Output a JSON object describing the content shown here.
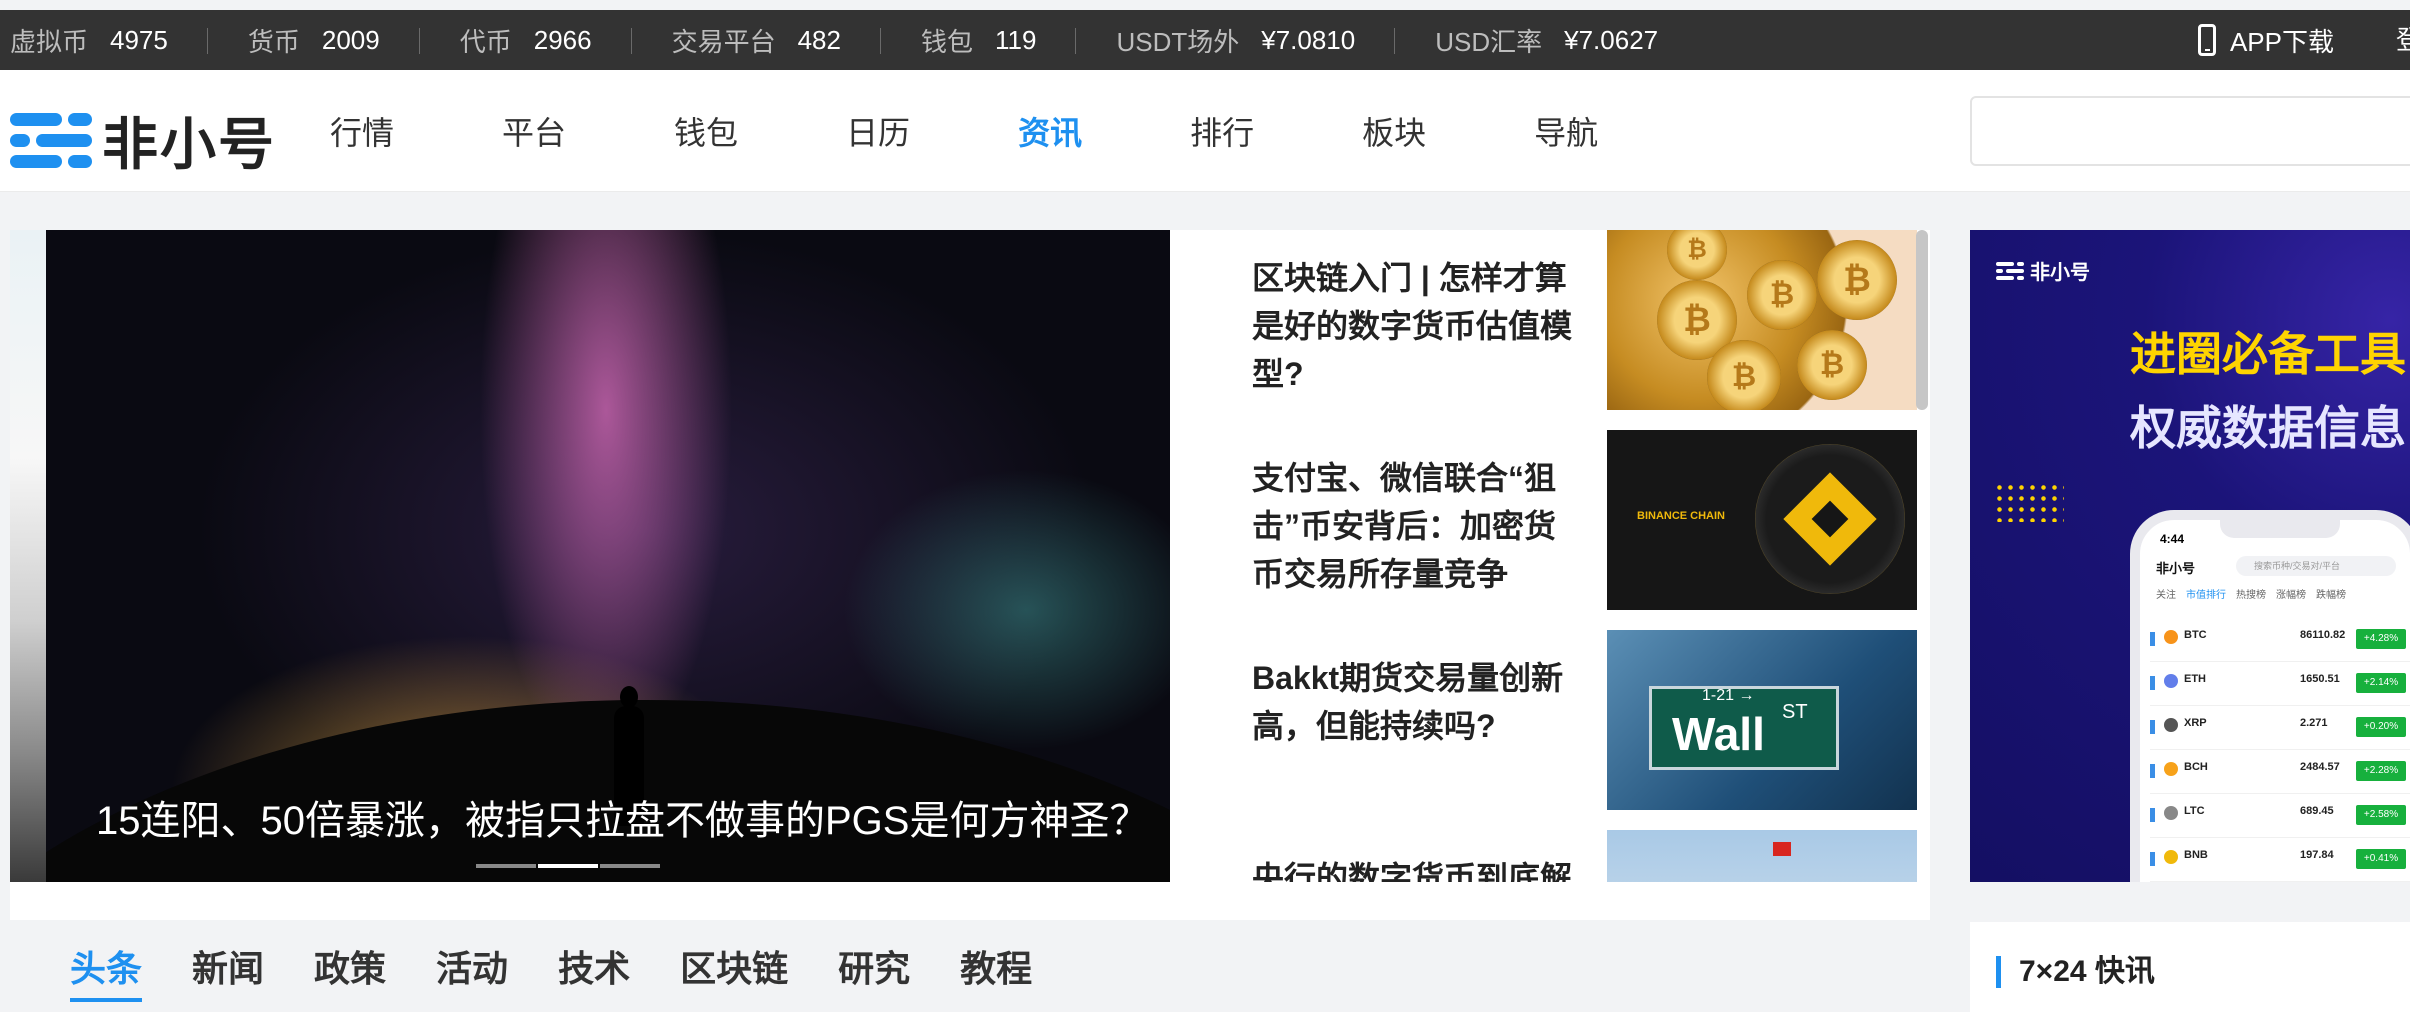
{
  "topbar": {
    "stats": [
      {
        "label": "虚拟币",
        "value": "4975"
      },
      {
        "label": "货币",
        "value": "2009"
      },
      {
        "label": "代币",
        "value": "2966"
      },
      {
        "label": "交易平台",
        "value": "482"
      },
      {
        "label": "钱包",
        "value": "119"
      },
      {
        "label": "USDT场外",
        "value": "¥7.0810"
      },
      {
        "label": "USD汇率",
        "value": "¥7.0627"
      }
    ],
    "app_download": "APP下载",
    "login": "登"
  },
  "nav": {
    "logo_text": "非小号",
    "links": [
      "行情",
      "平台",
      "钱包",
      "日历",
      "资讯",
      "排行",
      "板块",
      "导航"
    ],
    "active": "资讯"
  },
  "hero": {
    "title": "15连阳、50倍暴涨，被指只拉盘不做事的PGS是何方神圣？"
  },
  "news": [
    {
      "title": "区块链入门 | 怎样才算是好的数字货币估值模型?"
    },
    {
      "title": "支付宝、微信联合“狙击”币安背后：加密货币交易所存量竞争"
    },
    {
      "title": "Bakkt期货交易量创新高，但能持续吗?"
    },
    {
      "title": "央行的数字货币到底解"
    }
  ],
  "thumbs": {
    "binance_text": "BINANCE CHAIN",
    "wall_text": "Wall",
    "st_text": "ST",
    "sign_num": "1-21 →"
  },
  "tabs": [
    "头条",
    "新闻",
    "政策",
    "活动",
    "技术",
    "区块链",
    "研究",
    "教程"
  ],
  "ad": {
    "logo": "非小号",
    "headline1": "进圈必备工具",
    "headline2": "权威数据信息",
    "phone": {
      "time": "4:44",
      "app_name": "非小号",
      "search_placeholder": "搜索币种/交易对/平台",
      "tabs": [
        "关注",
        "市值排行",
        "热搜榜",
        "涨幅榜",
        "跌幅榜"
      ],
      "rows": [
        {
          "symbol": "BTC",
          "price": "86110.82",
          "change": "+4.28%"
        },
        {
          "symbol": "ETH",
          "price": "1650.51",
          "change": "+2.14%"
        },
        {
          "symbol": "XRP",
          "price": "2.271",
          "change": "+0.20%"
        },
        {
          "symbol": "BCH",
          "price": "2484.57",
          "change": "+2.28%"
        },
        {
          "symbol": "LTC",
          "price": "689.45",
          "change": "+2.58%"
        },
        {
          "symbol": "BNB",
          "price": "197.84",
          "change": "+0.41%"
        }
      ]
    }
  },
  "kuaixun": {
    "title": "7×24 快讯"
  },
  "colors": {
    "accent": "#1e90f0",
    "topbar_bg": "#333333",
    "up_green": "#17b03d"
  }
}
